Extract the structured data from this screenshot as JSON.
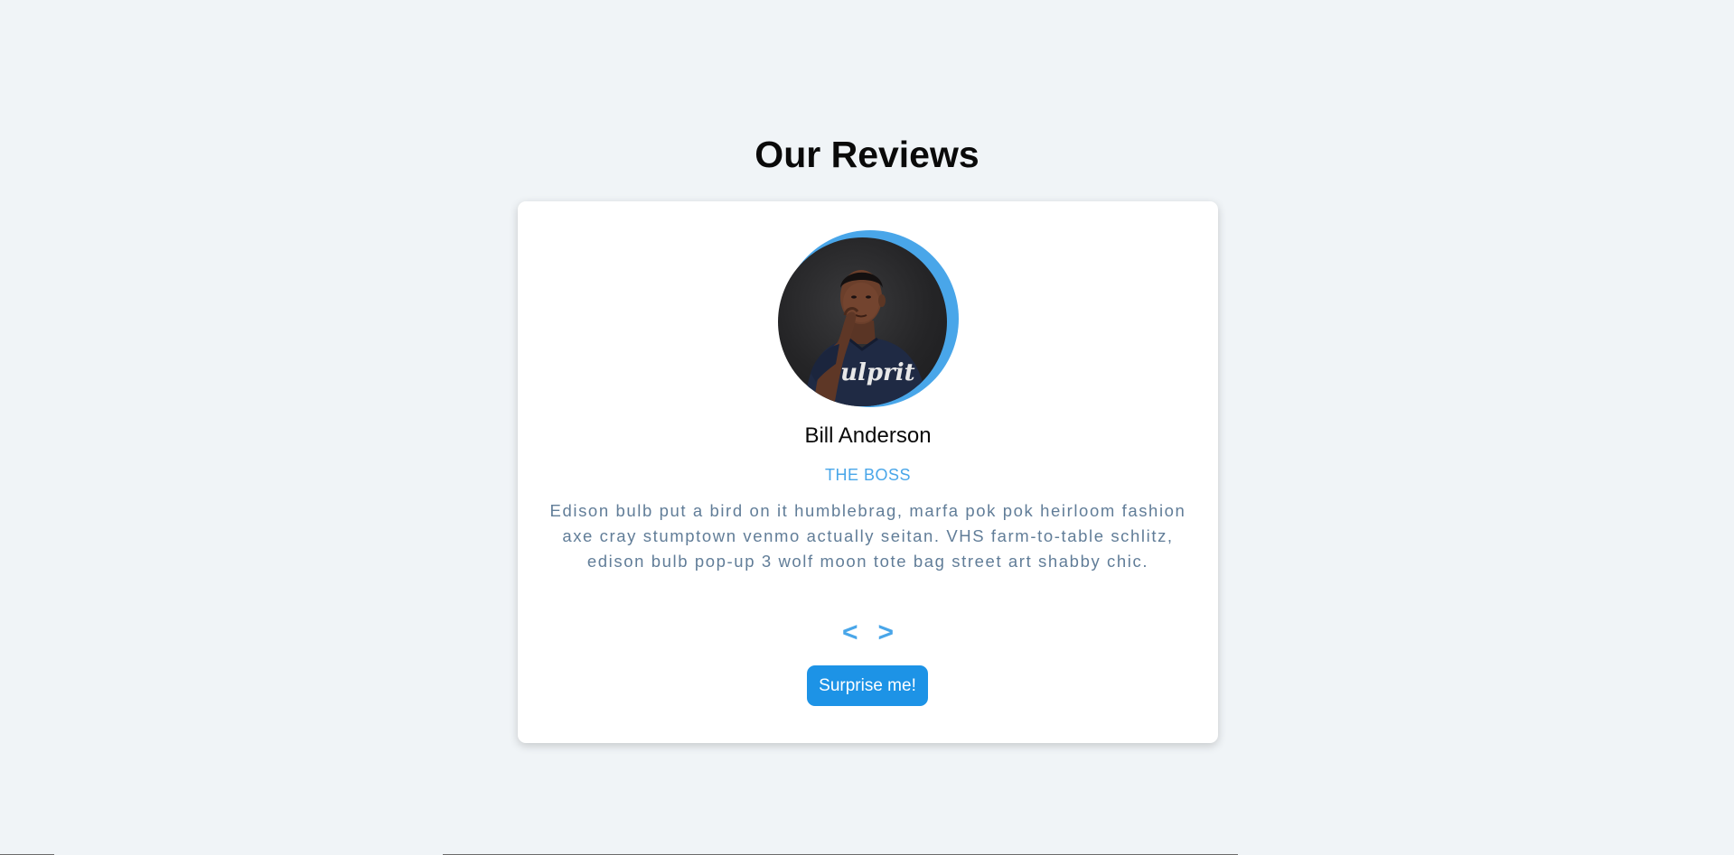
{
  "page": {
    "title": "Our Reviews"
  },
  "review": {
    "name": "Bill Anderson",
    "job": "THE BOSS",
    "text": "Edison bulb put a bird on it humblebrag, marfa pok pok heirloom fashion axe cray stumptown venmo actually seitan. VHS farm-to-table schlitz, edison bulb pop-up 3 wolf moon tote bag street art shabby chic.",
    "image_alt": "person-portrait",
    "shirt_text": "Culprit"
  },
  "controls": {
    "prev_label": "<",
    "next_label": ">",
    "random_label": "Surprise me!"
  },
  "colors": {
    "background": "#f0f4f7",
    "accent": "#49a6e9",
    "button": "#1d93e6",
    "card": "#ffffff"
  }
}
